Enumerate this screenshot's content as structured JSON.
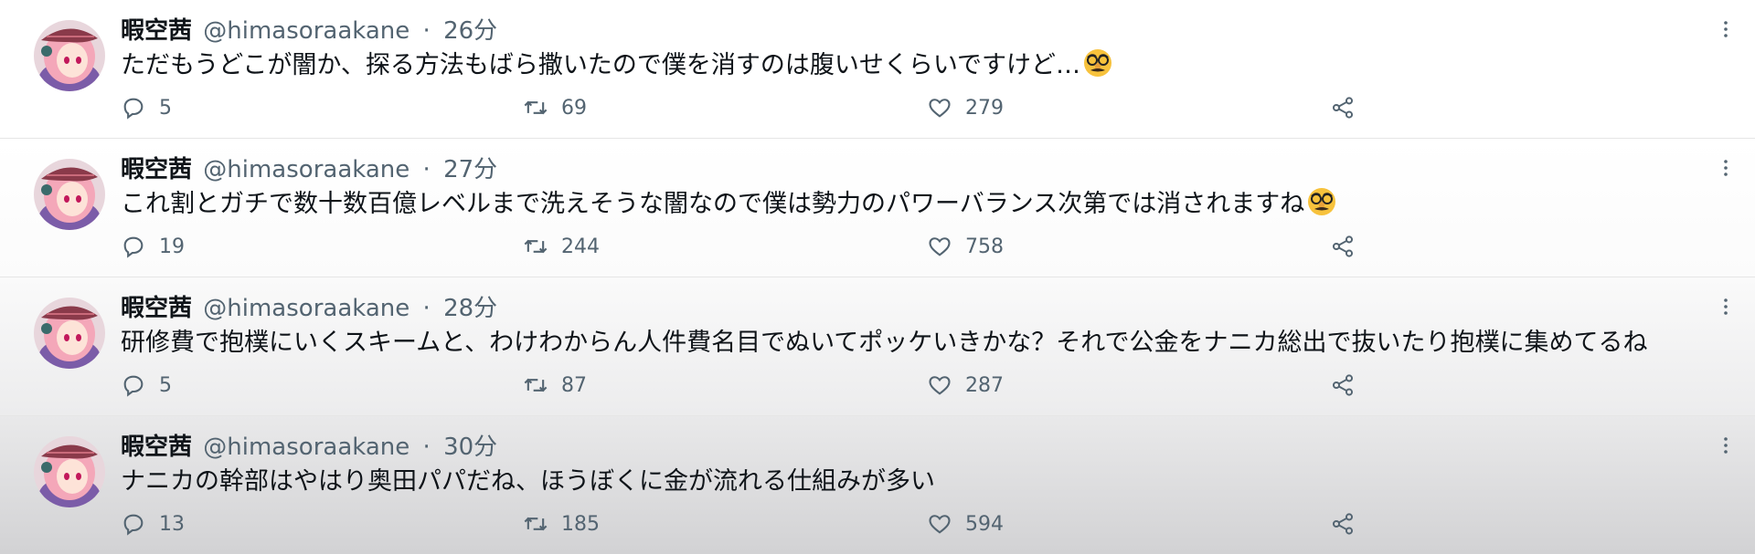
{
  "tweets": [
    {
      "name": "暇空茜",
      "handle": "@himasoraakane",
      "sep": "·",
      "time": "26分",
      "text": "ただもうどこが闇か、探る方法もばら撒いたので僕を消すのは腹いせくらいですけど…",
      "emoji": "disguised-face",
      "replies": "5",
      "retweets": "69",
      "likes": "279"
    },
    {
      "name": "暇空茜",
      "handle": "@himasoraakane",
      "sep": "·",
      "time": "27分",
      "text": "これ割とガチで数十数百億レベルまで洗えそうな闇なので僕は勢力のパワーバランス次第では消されますね",
      "emoji": "disguised-face",
      "replies": "19",
      "retweets": "244",
      "likes": "758"
    },
    {
      "name": "暇空茜",
      "handle": "@himasoraakane",
      "sep": "·",
      "time": "28分",
      "text": "研修費で抱樸にいくスキームと、わけわからん人件費名目でぬいてポッケいきかな？それで公金をナニカ総出で抜いたり抱樸に集めてるね",
      "emoji": "",
      "replies": "5",
      "retweets": "87",
      "likes": "287"
    },
    {
      "name": "暇空茜",
      "handle": "@himasoraakane",
      "sep": "·",
      "time": "30分",
      "text": "ナニカの幹部はやはり奥田パパだね、ほうぼくに金が流れる仕組みが多い",
      "emoji": "",
      "replies": "13",
      "retweets": "185",
      "likes": "594"
    }
  ],
  "colors": {
    "text": "#0f1419",
    "secondary": "#536471",
    "divider": "#e6e6e6"
  },
  "icons": [
    "reply-icon",
    "retweet-icon",
    "like-icon",
    "share-icon",
    "more-icon",
    "disguised-face-emoji"
  ]
}
